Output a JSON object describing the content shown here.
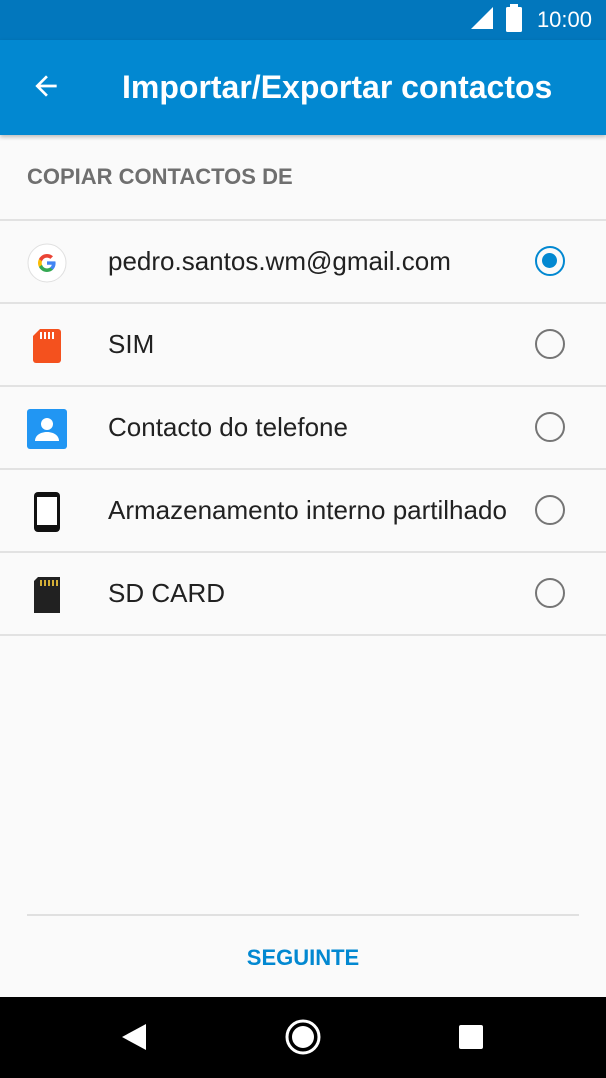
{
  "status_bar": {
    "time": "10:00",
    "signal_icon": "signal-icon",
    "battery_icon": "battery-icon"
  },
  "app_bar": {
    "back_icon": "arrow-back-icon",
    "title": "Importar/Exportar contactos",
    "color": "#0288d1"
  },
  "section": {
    "header": "COPIAR CONTACTOS DE"
  },
  "options": [
    {
      "icon": "google-icon",
      "label": "pedro.santos.wm@gmail.com",
      "selected": true
    },
    {
      "icon": "sim-card-icon",
      "label": "SIM",
      "selected": false
    },
    {
      "icon": "contact-phone-icon",
      "label": "Contacto do telefone",
      "selected": false
    },
    {
      "icon": "smartphone-icon",
      "label": "Armazenamento interno partilhado",
      "selected": false
    },
    {
      "icon": "sd-card-icon",
      "label": "SD CARD",
      "selected": false
    }
  ],
  "footer": {
    "next_label": "SEGUINTE"
  },
  "nav_bar": {
    "back_icon": "nav-back-icon",
    "home_icon": "nav-home-icon",
    "recents_icon": "nav-recents-icon"
  }
}
